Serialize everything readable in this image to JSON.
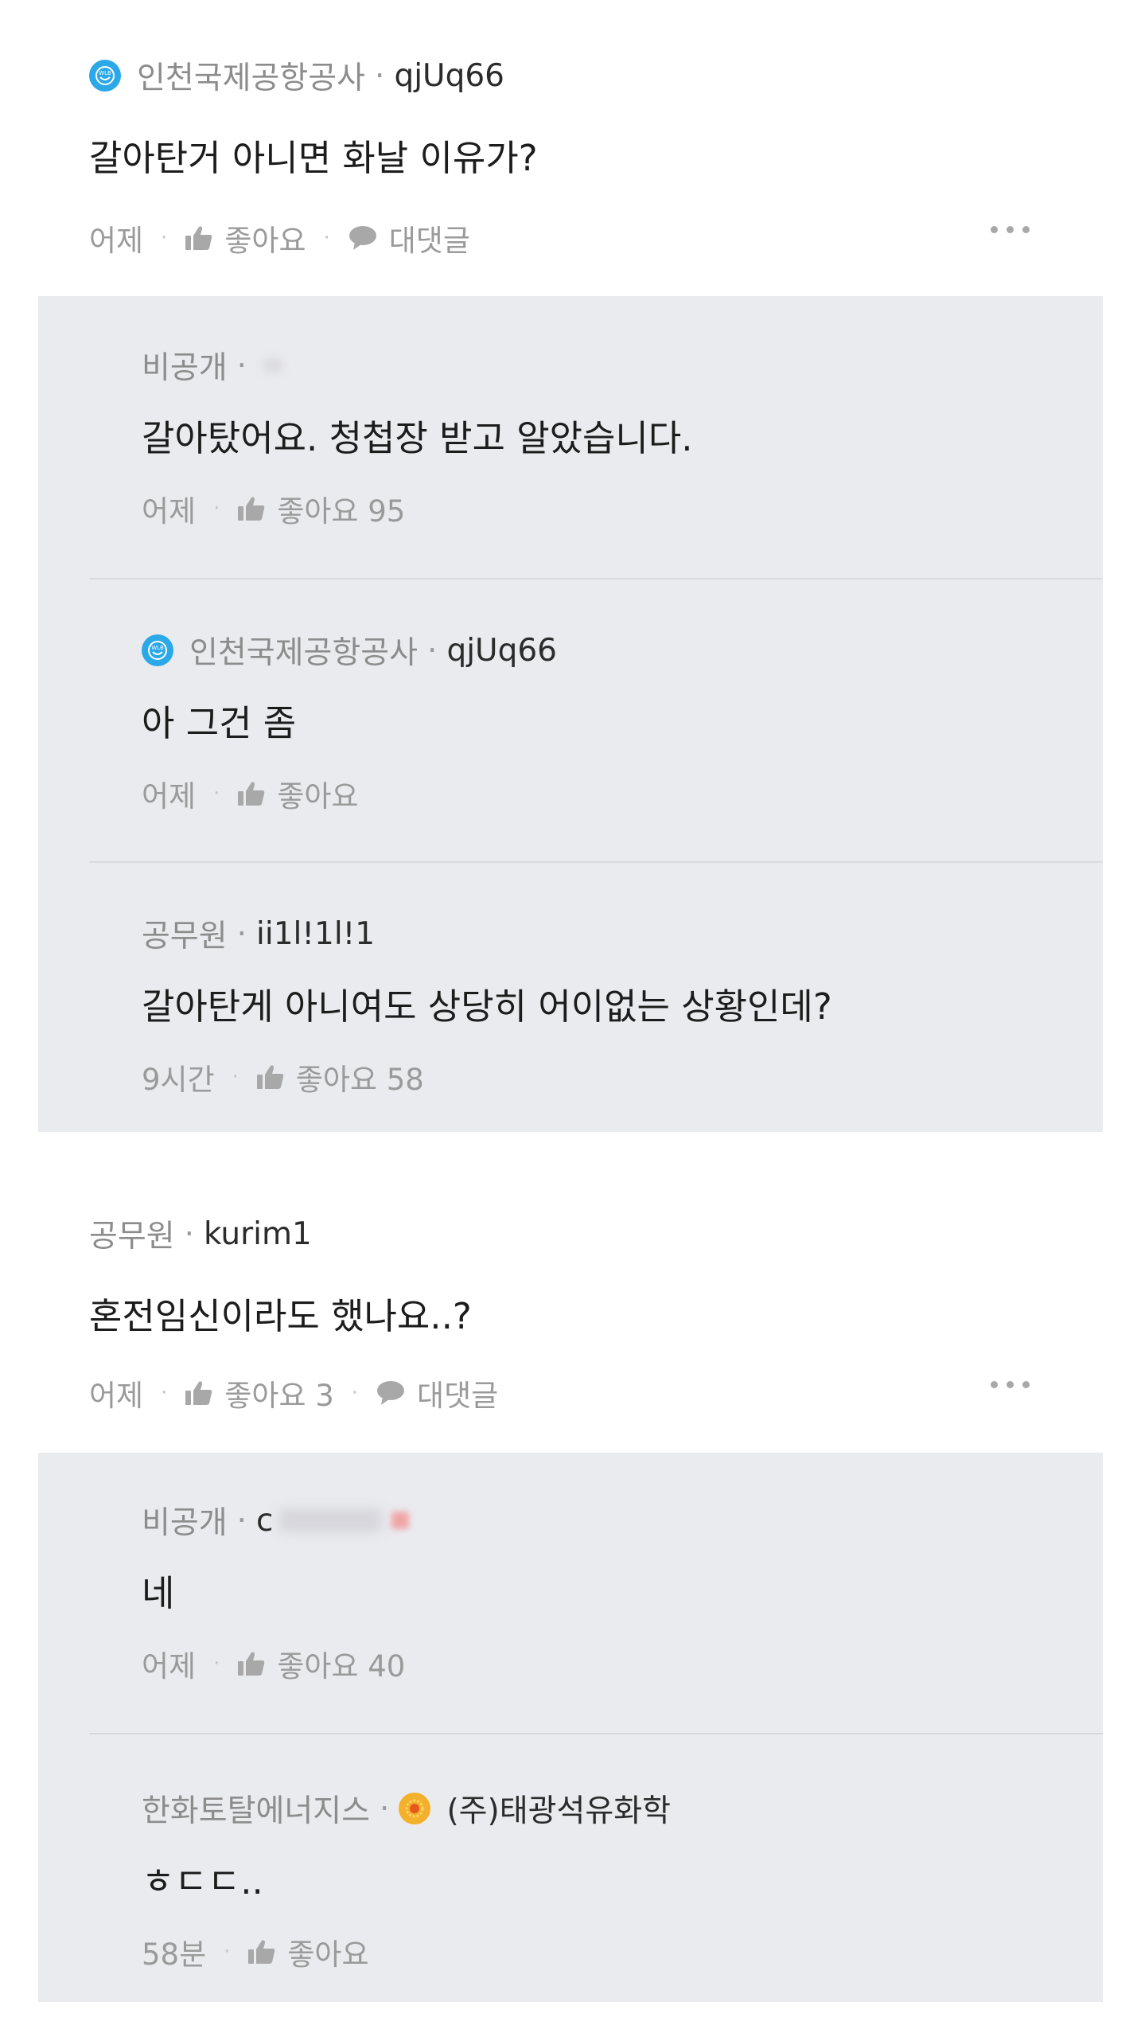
{
  "comments": [
    {
      "company": "인천국제공항공사",
      "nickname": "qjUq66",
      "text": "갈아탄거 아니면 화날 이유가?",
      "time": "어제",
      "like_label": "좋아요",
      "reply_label": "대댓글",
      "replies": [
        {
          "company": "비공개",
          "nickname": "",
          "text": "갈아탔어요. 청첩장 받고 알았습니다.",
          "time": "어제",
          "like_label": "좋아요 95"
        },
        {
          "company": "인천국제공항공사",
          "nickname": "qjUq66",
          "text": "아 그건 좀",
          "time": "어제",
          "like_label": "좋아요"
        },
        {
          "company": "공무원",
          "nickname": "ii1l!1l!1",
          "text": "갈아탄게 아니여도 상당히 어이없는 상황인데?",
          "time": "9시간",
          "like_label": "좋아요 58"
        }
      ]
    },
    {
      "company": "공무원",
      "nickname": "kurim1",
      "text": "혼전임신이라도 했나요..?",
      "time": "어제",
      "like_label": "좋아요 3",
      "reply_label": "대댓글",
      "replies": [
        {
          "company": "비공개",
          "nickname": "c",
          "text": "네",
          "time": "어제",
          "like_label": "좋아요 40"
        },
        {
          "company": "한화토탈에너지스",
          "nickname": "(주)태광석유화학",
          "text": "ㅎㄷㄷ..",
          "time": "58분",
          "like_label": "좋아요"
        }
      ]
    }
  ],
  "icons": {
    "like": "thumbs-up-icon",
    "reply": "speech-bubble-icon",
    "more": "more-dots-icon",
    "company_badge": "company-logo-icon"
  },
  "colors": {
    "reply_background": "#eaebef",
    "meta_gray": "#8c8c8c",
    "badge_blue": "#2aa8e8",
    "badge_orange": "#f3b02a"
  }
}
